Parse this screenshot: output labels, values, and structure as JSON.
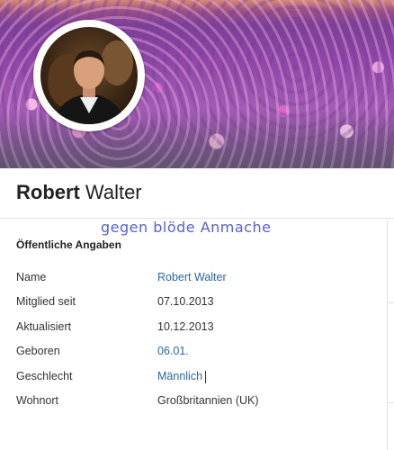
{
  "profile": {
    "first_name": "Robert",
    "last_name": "Walter"
  },
  "overlay_text": "gegen blöde Anmache",
  "section": {
    "title": "Öffentliche Angaben",
    "rows": [
      {
        "label": "Name",
        "value": "Robert Walter",
        "link": true
      },
      {
        "label": "Mitglied seit",
        "value": "07.10.2013",
        "link": false
      },
      {
        "label": "Aktualisiert",
        "value": "10.12.2013",
        "link": false
      },
      {
        "label": "Geboren",
        "value": "06.01.",
        "link": true
      },
      {
        "label": "Geschlecht",
        "value": "Männlich",
        "link": true
      },
      {
        "label": "Wohnort",
        "value": "Großbritannien (UK)",
        "link": false
      }
    ]
  },
  "colors": {
    "link": "#2a66a6",
    "overlay_text": "#5560d6",
    "text": "#333333"
  }
}
